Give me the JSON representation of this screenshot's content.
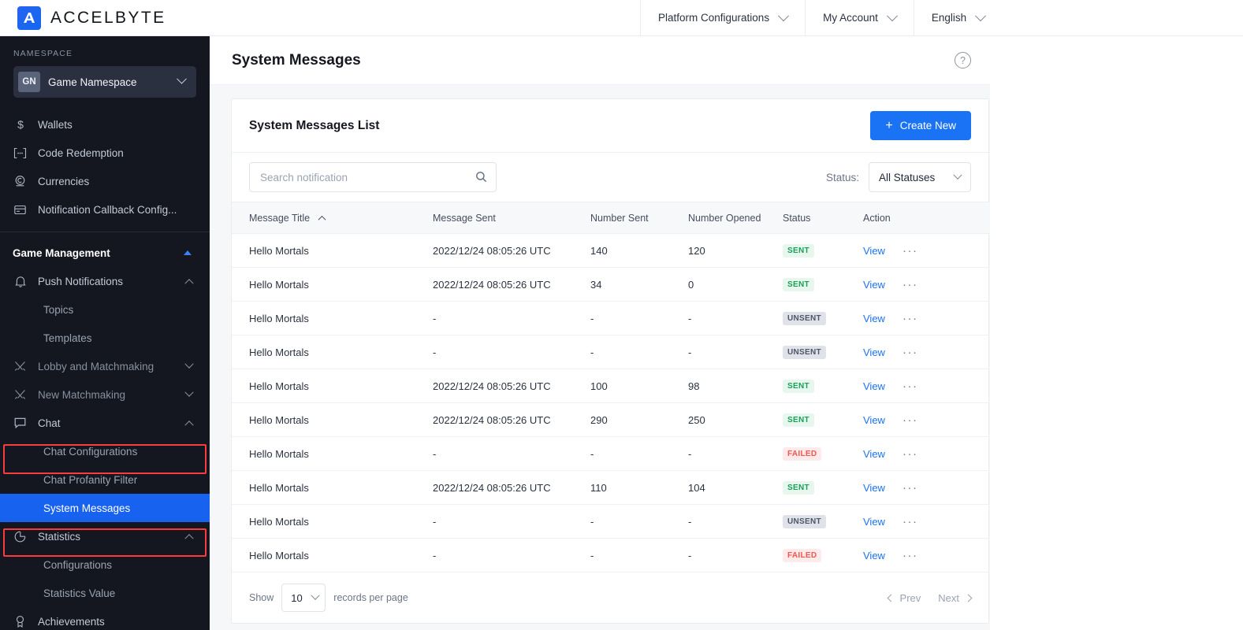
{
  "topbar": {
    "brand": "ACCELBYTE",
    "nav": [
      {
        "label": "Platform Configurations"
      },
      {
        "label": "My Account"
      },
      {
        "label": "English"
      }
    ]
  },
  "sidebar": {
    "namespace_label": "NAMESPACE",
    "namespace_initials": "GN",
    "namespace_name": "Game Namespace",
    "items": [
      {
        "label": "Wallets",
        "icon": "dollar-icon",
        "type": "item"
      },
      {
        "label": "Code Redemption",
        "icon": "code-icon",
        "type": "item"
      },
      {
        "label": "Currencies",
        "icon": "currency-icon",
        "type": "item"
      },
      {
        "label": "Notification Callback Config...",
        "icon": "callback-icon",
        "type": "item"
      }
    ],
    "section_title": "Game Management",
    "groups": [
      {
        "label": "Push Notifications",
        "icon": "bell-icon",
        "expanded": true,
        "children": [
          {
            "label": "Topics"
          },
          {
            "label": "Templates"
          }
        ]
      },
      {
        "label": "Lobby and Matchmaking",
        "icon": "swords-icon",
        "expanded": false,
        "children": []
      },
      {
        "label": "New Matchmaking",
        "icon": "swords-icon",
        "expanded": false,
        "children": []
      },
      {
        "label": "Chat",
        "icon": "chat-bubble-icon",
        "expanded": true,
        "highlighted": true,
        "children": [
          {
            "label": "Chat Configurations"
          },
          {
            "label": "Chat Profanity Filter"
          },
          {
            "label": "System Messages",
            "active": true,
            "highlighted": true
          }
        ]
      },
      {
        "label": "Statistics",
        "icon": "pie-chart-icon",
        "expanded": true,
        "children": [
          {
            "label": "Configurations"
          },
          {
            "label": "Statistics Value"
          }
        ]
      },
      {
        "label": "Achievements",
        "icon": "medal-icon",
        "expanded": false,
        "children": []
      }
    ]
  },
  "page": {
    "title": "System Messages",
    "help_icon": "?"
  },
  "card": {
    "title": "System Messages List",
    "create_button": "Create New",
    "create_button_icon": "+",
    "search_placeholder": "Search notification",
    "search_value": "",
    "status_filter_label": "Status:",
    "status_filter_value": "All Statuses"
  },
  "table": {
    "columns": [
      {
        "label": "Message Title",
        "sorted": "asc"
      },
      {
        "label": "Message Sent"
      },
      {
        "label": "Number Sent"
      },
      {
        "label": "Number Opened"
      },
      {
        "label": "Status"
      },
      {
        "label": "Action"
      }
    ],
    "action_view_label": "View",
    "action_more_label": "···",
    "rows": [
      {
        "title": "Hello Mortals",
        "sent": "2022/12/24 08:05:26 UTC",
        "number_sent": "140",
        "number_opened": "120",
        "status": "SENT"
      },
      {
        "title": "Hello Mortals",
        "sent": "2022/12/24 08:05:26 UTC",
        "number_sent": "34",
        "number_opened": "0",
        "status": "SENT"
      },
      {
        "title": "Hello Mortals",
        "sent": "-",
        "number_sent": "-",
        "number_opened": "-",
        "status": "UNSENT"
      },
      {
        "title": "Hello Mortals",
        "sent": "-",
        "number_sent": "-",
        "number_opened": "-",
        "status": "UNSENT"
      },
      {
        "title": "Hello Mortals",
        "sent": "2022/12/24 08:05:26 UTC",
        "number_sent": "100",
        "number_opened": "98",
        "status": "SENT"
      },
      {
        "title": "Hello Mortals",
        "sent": "2022/12/24 08:05:26 UTC",
        "number_sent": "290",
        "number_opened": "250",
        "status": "SENT"
      },
      {
        "title": "Hello Mortals",
        "sent": "-",
        "number_sent": "-",
        "number_opened": "-",
        "status": "FAILED"
      },
      {
        "title": "Hello Mortals",
        "sent": "2022/12/24 08:05:26 UTC",
        "number_sent": "110",
        "number_opened": "104",
        "status": "SENT"
      },
      {
        "title": "Hello Mortals",
        "sent": "-",
        "number_sent": "-",
        "number_opened": "-",
        "status": "UNSENT"
      },
      {
        "title": "Hello Mortals",
        "sent": "-",
        "number_sent": "-",
        "number_opened": "-",
        "status": "FAILED"
      }
    ]
  },
  "footer": {
    "show_label": "Show",
    "page_size": "10",
    "records_label": "records per page",
    "prev_label": "Prev",
    "next_label": "Next"
  },
  "colors": {
    "accent": "#1a73f5",
    "sidebar_bg": "#14171f",
    "active_item": "#1862f0",
    "annotation": "#fa3c3c",
    "status_sent": "#18a058",
    "status_unsent": "#4d5668",
    "status_failed": "#f5544f"
  }
}
